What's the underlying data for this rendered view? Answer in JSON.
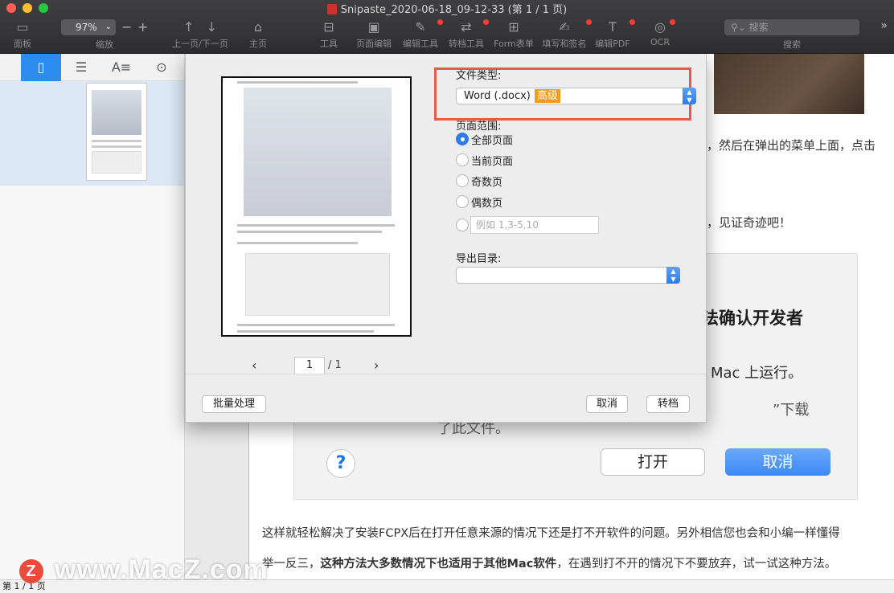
{
  "window": {
    "title": "Snipaste_2020-06-18_09-12-33 (第 1 / 1 页)"
  },
  "toolbar": {
    "sidebar_label": "面板",
    "zoom_value": "97%",
    "zoom_label": "缩放",
    "nav_label": "上一页/下一页",
    "home_label": "主页",
    "tools_label": "工具",
    "page_edit_label": "页面编辑",
    "edit_tools_label": "编辑工具",
    "convert_tools_label": "转档工具",
    "form_label": "Form表单",
    "fill_sign_label": "填写和签名",
    "edit_pdf_label": "编辑PDF",
    "ocr_label": "OCR",
    "search_placeholder": "搜索",
    "search_label": "搜索"
  },
  "dialog": {
    "file_type_label": "文件类型:",
    "file_type_value": "Word (.docx)",
    "advanced_badge": "高级",
    "page_range_label": "页面范围:",
    "range_options": [
      "全部页面",
      "当前页面",
      "奇数页",
      "偶数页"
    ],
    "custom_range_placeholder": "例如 1,3-5,10",
    "export_dir_label": "导出目录:",
    "export_dir_value": "",
    "page_current": "1",
    "page_total": "/ 1",
    "batch_button": "批量处理",
    "cancel_button": "取消",
    "convert_button": "转档"
  },
  "document": {
    "line1": "，然后在弹出的菜单上面，点击",
    "line2": "，见证奇迹吧！",
    "shot_title": "法确认开发者",
    "shot_mac": "Mac 上运行。",
    "shot_download": "”下载",
    "shot_file": "了此文件。",
    "shot_open": "打开",
    "shot_cancel": "取消",
    "para1": "这样就轻松解决了安装FCPX后在打开任意来源的情况下还是打不开软件的问题。另外相信您也会和小编一样懂得",
    "para2_a": "举一反三，",
    "para2_b": "这种方法大多数情况下也适用于其他Mac软件",
    "para2_c": "，在遇到打不开的情况下不要放弃，试一试这种方法。"
  },
  "status": {
    "page_info": "第 1 / 1 页"
  },
  "watermark": {
    "text": "www.MacZ.com",
    "logo_letter": "Z"
  },
  "colors": {
    "accent": "#2d8cf0",
    "highlight_box": "#e55a4d",
    "badge": "#f39b1d"
  }
}
